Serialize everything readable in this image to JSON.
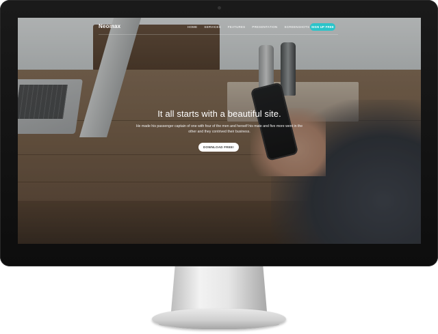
{
  "site": {
    "brand": "Neomax",
    "nav_links": [
      "HOME",
      "SERVICES",
      "FEATURES",
      "PRESENTATION",
      "SCREENSHOTS",
      "SUBSCRIBE"
    ],
    "signup_label": "SIGN UP FREE",
    "hero_title": "It all starts with a beautiful site.",
    "hero_text": "He made his passenger captain of one with four of the men and herself his mate and five more went in the other and they contrived their business.",
    "cta_label": "DOWNLOAD FREE!"
  },
  "colors": {
    "accent": "#2bc4c9",
    "bezel": "#111111",
    "stand": "#dcdcdc"
  }
}
